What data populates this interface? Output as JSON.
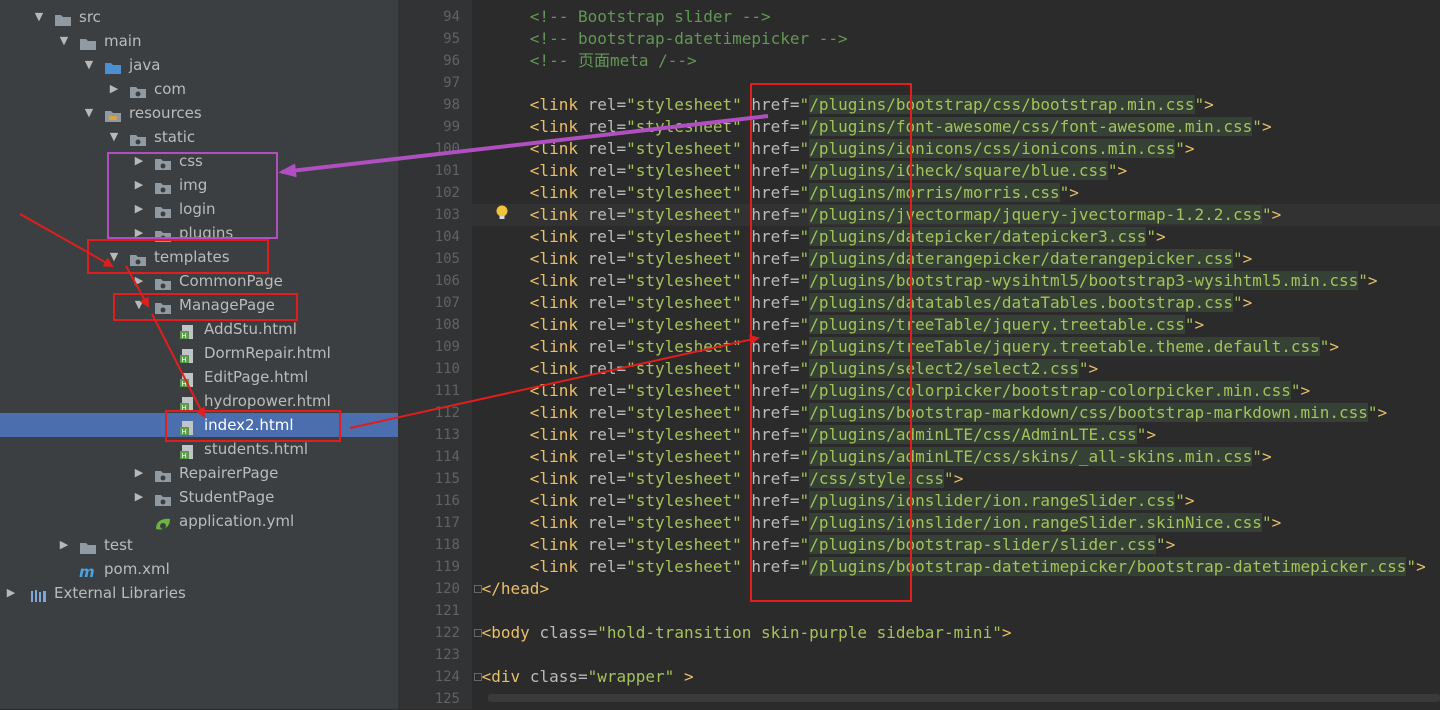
{
  "project_tree": [
    {
      "label": "src",
      "type": "folder",
      "arrow": "▼",
      "depth": 0
    },
    {
      "label": "main",
      "type": "folder",
      "arrow": "▼",
      "depth": 1
    },
    {
      "label": "java",
      "type": "folder-blue",
      "arrow": "▼",
      "depth": 2
    },
    {
      "label": "com",
      "type": "package",
      "arrow": "▶",
      "depth": 3
    },
    {
      "label": "resources",
      "type": "folder-res",
      "arrow": "▼",
      "depth": 2
    },
    {
      "label": "static",
      "type": "package",
      "arrow": "▼",
      "depth": 3
    },
    {
      "label": "css",
      "type": "package",
      "arrow": "▶",
      "depth": 4
    },
    {
      "label": "img",
      "type": "package",
      "arrow": "▶",
      "depth": 4
    },
    {
      "label": "login",
      "type": "package",
      "arrow": "▶",
      "depth": 4
    },
    {
      "label": "plugins",
      "type": "package",
      "arrow": "▶",
      "depth": 4
    },
    {
      "label": "templates",
      "type": "package",
      "arrow": "▼",
      "depth": 3
    },
    {
      "label": "CommonPage",
      "type": "package",
      "arrow": "▶",
      "depth": 4
    },
    {
      "label": "ManagePage",
      "type": "package",
      "arrow": "▼",
      "depth": 4
    },
    {
      "label": "AddStu.html",
      "type": "html",
      "arrow": "",
      "depth": 5
    },
    {
      "label": "DormRepair.html",
      "type": "html",
      "arrow": "",
      "depth": 5
    },
    {
      "label": "EditPage.html",
      "type": "html",
      "arrow": "",
      "depth": 5
    },
    {
      "label": "hydropower.html",
      "type": "html",
      "arrow": "",
      "depth": 5
    },
    {
      "label": "index2.html",
      "type": "html",
      "arrow": "",
      "depth": 5,
      "selected": true
    },
    {
      "label": "students.html",
      "type": "html",
      "arrow": "",
      "depth": 5
    },
    {
      "label": "RepairerPage",
      "type": "package",
      "arrow": "▶",
      "depth": 4
    },
    {
      "label": "StudentPage",
      "type": "package",
      "arrow": "▶",
      "depth": 4
    },
    {
      "label": "application.yml",
      "type": "yml",
      "arrow": "",
      "depth": 4
    },
    {
      "label": "test",
      "type": "folder",
      "arrow": "▶",
      "depth": 1
    },
    {
      "label": "pom.xml",
      "type": "maven",
      "arrow": "",
      "depth": 1
    },
    {
      "label": "External Libraries",
      "type": "libs",
      "arrow": "▶",
      "depth": -1
    }
  ],
  "editor": {
    "lines": [
      {
        "no": "94",
        "kind": "comment",
        "text": "<!-- Bootstrap slider -->"
      },
      {
        "no": "95",
        "kind": "comment",
        "text": "<!-- bootstrap-datetimepicker -->"
      },
      {
        "no": "96",
        "kind": "comment",
        "text": "<!-- 页面meta /-->"
      },
      {
        "no": "97",
        "kind": "blank",
        "text": ""
      },
      {
        "no": "98",
        "kind": "link",
        "href": "/plugins/bootstrap/css/bootstrap.min.css"
      },
      {
        "no": "99",
        "kind": "link",
        "href": "/plugins/font-awesome/css/font-awesome.min.css"
      },
      {
        "no": "100",
        "kind": "link",
        "href": "/plugins/ionicons/css/ionicons.min.css"
      },
      {
        "no": "101",
        "kind": "link",
        "href": "/plugins/iCheck/square/blue.css"
      },
      {
        "no": "102",
        "kind": "link",
        "href": "/plugins/morris/morris.css"
      },
      {
        "no": "103",
        "kind": "link",
        "href": "/plugins/jvectormap/jquery-jvectormap-1.2.2.css",
        "current": true
      },
      {
        "no": "104",
        "kind": "link",
        "href": "/plugins/datepicker/datepicker3.css"
      },
      {
        "no": "105",
        "kind": "link",
        "href": "/plugins/daterangepicker/daterangepicker.css"
      },
      {
        "no": "106",
        "kind": "link",
        "href": "/plugins/bootstrap-wysihtml5/bootstrap3-wysihtml5.min.css"
      },
      {
        "no": "107",
        "kind": "link",
        "href": "/plugins/datatables/dataTables.bootstrap.css"
      },
      {
        "no": "108",
        "kind": "link",
        "href": "/plugins/treeTable/jquery.treetable.css"
      },
      {
        "no": "109",
        "kind": "link",
        "href": "/plugins/treeTable/jquery.treetable.theme.default.css"
      },
      {
        "no": "110",
        "kind": "link",
        "href": "/plugins/select2/select2.css"
      },
      {
        "no": "111",
        "kind": "link",
        "href": "/plugins/colorpicker/bootstrap-colorpicker.min.css"
      },
      {
        "no": "112",
        "kind": "link",
        "href": "/plugins/bootstrap-markdown/css/bootstrap-markdown.min.css"
      },
      {
        "no": "113",
        "kind": "link",
        "href": "/plugins/adminLTE/css/AdminLTE.css"
      },
      {
        "no": "114",
        "kind": "link",
        "href": "/plugins/adminLTE/css/skins/_all-skins.min.css"
      },
      {
        "no": "115",
        "kind": "link",
        "href": "/css/style.css"
      },
      {
        "no": "116",
        "kind": "link",
        "href": "/plugins/ionslider/ion.rangeSlider.css"
      },
      {
        "no": "117",
        "kind": "link",
        "href": "/plugins/ionslider/ion.rangeSlider.skinNice.css"
      },
      {
        "no": "118",
        "kind": "link",
        "href": "/plugins/bootstrap-slider/slider.css"
      },
      {
        "no": "119",
        "kind": "link",
        "href": "/plugins/bootstrap-datetimepicker/bootstrap-datetimepicker.css"
      },
      {
        "no": "120",
        "kind": "close",
        "tag": "head"
      },
      {
        "no": "121",
        "kind": "blank",
        "text": ""
      },
      {
        "no": "122",
        "kind": "open",
        "tag": "body",
        "attr": "class",
        "value": "hold-transition skin-purple sidebar-mini"
      },
      {
        "no": "123",
        "kind": "blank",
        "text": ""
      },
      {
        "no": "124",
        "kind": "open",
        "tag": "div",
        "attr": "class",
        "value": "wrapper",
        "trail": " "
      },
      {
        "no": "125",
        "kind": "blank",
        "text": ""
      }
    ],
    "link_tag": "link",
    "rel_attr": "rel",
    "rel_value": "stylesheet",
    "href_attr": "href"
  },
  "annotations": {
    "red": "#e01e1e",
    "purple": "#b04fc0"
  },
  "colors": {
    "tree_bg": "#3c3f41",
    "editor_bg": "#2b2b2b",
    "selection": "#4b6eaf",
    "tag": "#e8bf6a",
    "string": "#a5c25c",
    "comment": "#629755"
  }
}
